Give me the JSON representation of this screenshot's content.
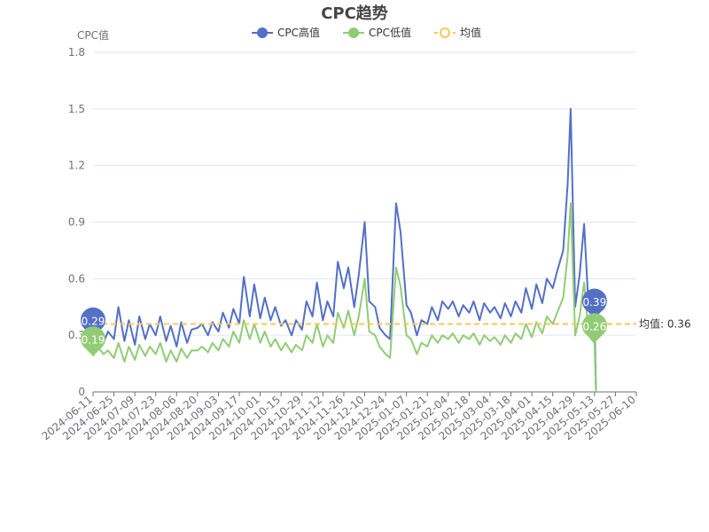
{
  "chart_data": {
    "type": "line",
    "title": "CPC趋势",
    "ylabel": "CPC值",
    "xlabel": "",
    "ylim": [
      0,
      1.8
    ],
    "yticks": [
      "0",
      "0.3",
      "0.6",
      "0.9",
      "1.2",
      "1.5",
      "1.8"
    ],
    "xticks": [
      "2024-06-11",
      "2024-06-25",
      "2024-07-09",
      "2024-07-23",
      "2024-08-06",
      "2024-08-20",
      "2024-09-03",
      "2024-09-17",
      "2024-10-01",
      "2024-10-15",
      "2024-10-29",
      "2024-11-12",
      "2024-11-26",
      "2024-12-10",
      "2024-12-24",
      "2025-01-07",
      "2025-01-21",
      "2025-02-04",
      "2025-02-18",
      "2025-03-04",
      "2025-03-18",
      "2025-04-01",
      "2025-04-15",
      "2025-04-29",
      "2025-05-13",
      "2025-05-27",
      "2025-06-10"
    ],
    "x_start": "2024-06-11",
    "x_end": "2025-06-10",
    "grid": true,
    "legend_position": "top-center",
    "series": [
      {
        "name": "CPC高值",
        "color": "#5470c6",
        "points": [
          [
            "2024-06-11",
            0.29
          ],
          [
            "2024-06-14",
            0.33
          ],
          [
            "2024-06-18",
            0.26
          ],
          [
            "2024-06-21",
            0.32
          ],
          [
            "2024-06-25",
            0.28
          ],
          [
            "2024-06-28",
            0.45
          ],
          [
            "2024-07-02",
            0.27
          ],
          [
            "2024-07-05",
            0.38
          ],
          [
            "2024-07-09",
            0.25
          ],
          [
            "2024-07-12",
            0.4
          ],
          [
            "2024-07-16",
            0.28
          ],
          [
            "2024-07-19",
            0.36
          ],
          [
            "2024-07-23",
            0.3
          ],
          [
            "2024-07-26",
            0.4
          ],
          [
            "2024-07-30",
            0.27
          ],
          [
            "2024-08-02",
            0.35
          ],
          [
            "2024-08-06",
            0.24
          ],
          [
            "2024-08-09",
            0.37
          ],
          [
            "2024-08-13",
            0.26
          ],
          [
            "2024-08-16",
            0.33
          ],
          [
            "2024-08-20",
            0.34
          ],
          [
            "2024-08-23",
            0.36
          ],
          [
            "2024-08-27",
            0.3
          ],
          [
            "2024-08-30",
            0.37
          ],
          [
            "2024-09-03",
            0.32
          ],
          [
            "2024-09-06",
            0.42
          ],
          [
            "2024-09-10",
            0.34
          ],
          [
            "2024-09-13",
            0.44
          ],
          [
            "2024-09-17",
            0.36
          ],
          [
            "2024-09-20",
            0.61
          ],
          [
            "2024-09-24",
            0.4
          ],
          [
            "2024-09-27",
            0.57
          ],
          [
            "2024-10-01",
            0.39
          ],
          [
            "2024-10-04",
            0.5
          ],
          [
            "2024-10-08",
            0.38
          ],
          [
            "2024-10-11",
            0.45
          ],
          [
            "2024-10-15",
            0.35
          ],
          [
            "2024-10-18",
            0.38
          ],
          [
            "2024-10-22",
            0.3
          ],
          [
            "2024-10-25",
            0.38
          ],
          [
            "2024-10-29",
            0.33
          ],
          [
            "2024-11-01",
            0.48
          ],
          [
            "2024-11-05",
            0.4
          ],
          [
            "2024-11-08",
            0.58
          ],
          [
            "2024-11-12",
            0.38
          ],
          [
            "2024-11-15",
            0.48
          ],
          [
            "2024-11-19",
            0.4
          ],
          [
            "2024-11-22",
            0.69
          ],
          [
            "2024-11-26",
            0.55
          ],
          [
            "2024-11-29",
            0.66
          ],
          [
            "2024-12-03",
            0.45
          ],
          [
            "2024-12-06",
            0.62
          ],
          [
            "2024-12-10",
            0.9
          ],
          [
            "2024-12-13",
            0.48
          ],
          [
            "2024-12-17",
            0.45
          ],
          [
            "2024-12-20",
            0.34
          ],
          [
            "2024-12-24",
            0.3
          ],
          [
            "2024-12-27",
            0.28
          ],
          [
            "2024-12-31",
            1.0
          ],
          [
            "2025-01-03",
            0.85
          ],
          [
            "2025-01-07",
            0.46
          ],
          [
            "2025-01-10",
            0.42
          ],
          [
            "2025-01-14",
            0.3
          ],
          [
            "2025-01-17",
            0.38
          ],
          [
            "2025-01-21",
            0.36
          ],
          [
            "2025-01-24",
            0.45
          ],
          [
            "2025-01-28",
            0.38
          ],
          [
            "2025-01-31",
            0.48
          ],
          [
            "2025-02-04",
            0.44
          ],
          [
            "2025-02-07",
            0.48
          ],
          [
            "2025-02-11",
            0.4
          ],
          [
            "2025-02-14",
            0.46
          ],
          [
            "2025-02-18",
            0.42
          ],
          [
            "2025-02-21",
            0.48
          ],
          [
            "2025-02-25",
            0.38
          ],
          [
            "2025-02-28",
            0.47
          ],
          [
            "2025-03-04",
            0.42
          ],
          [
            "2025-03-07",
            0.45
          ],
          [
            "2025-03-11",
            0.39
          ],
          [
            "2025-03-14",
            0.47
          ],
          [
            "2025-03-18",
            0.4
          ],
          [
            "2025-03-21",
            0.48
          ],
          [
            "2025-03-25",
            0.42
          ],
          [
            "2025-03-28",
            0.55
          ],
          [
            "2025-04-01",
            0.44
          ],
          [
            "2025-04-04",
            0.57
          ],
          [
            "2025-04-08",
            0.47
          ],
          [
            "2025-04-11",
            0.6
          ],
          [
            "2025-04-15",
            0.55
          ],
          [
            "2025-04-18",
            0.64
          ],
          [
            "2025-04-22",
            0.75
          ],
          [
            "2025-04-25",
            1.1
          ],
          [
            "2025-04-27",
            1.5
          ],
          [
            "2025-04-30",
            0.45
          ],
          [
            "2025-05-03",
            0.62
          ],
          [
            "2025-05-06",
            0.89
          ],
          [
            "2025-05-09",
            0.45
          ],
          [
            "2025-05-13",
            0.39
          ],
          [
            "2025-05-14",
            0.0
          ]
        ],
        "start_label": "0.29",
        "end_label": "0.39"
      },
      {
        "name": "CPC低值",
        "color": "#91cc75",
        "points": [
          [
            "2024-06-11",
            0.19
          ],
          [
            "2024-06-14",
            0.24
          ],
          [
            "2024-06-18",
            0.2
          ],
          [
            "2024-06-21",
            0.22
          ],
          [
            "2024-06-25",
            0.18
          ],
          [
            "2024-06-28",
            0.26
          ],
          [
            "2024-07-02",
            0.16
          ],
          [
            "2024-07-05",
            0.24
          ],
          [
            "2024-07-09",
            0.17
          ],
          [
            "2024-07-12",
            0.25
          ],
          [
            "2024-07-16",
            0.19
          ],
          [
            "2024-07-19",
            0.24
          ],
          [
            "2024-07-23",
            0.2
          ],
          [
            "2024-07-26",
            0.26
          ],
          [
            "2024-07-30",
            0.16
          ],
          [
            "2024-08-02",
            0.22
          ],
          [
            "2024-08-06",
            0.16
          ],
          [
            "2024-08-09",
            0.23
          ],
          [
            "2024-08-13",
            0.18
          ],
          [
            "2024-08-16",
            0.22
          ],
          [
            "2024-08-20",
            0.22
          ],
          [
            "2024-08-23",
            0.24
          ],
          [
            "2024-08-27",
            0.21
          ],
          [
            "2024-08-30",
            0.26
          ],
          [
            "2024-09-03",
            0.22
          ],
          [
            "2024-09-06",
            0.28
          ],
          [
            "2024-09-10",
            0.24
          ],
          [
            "2024-09-13",
            0.32
          ],
          [
            "2024-09-17",
            0.26
          ],
          [
            "2024-09-20",
            0.38
          ],
          [
            "2024-09-24",
            0.28
          ],
          [
            "2024-09-27",
            0.36
          ],
          [
            "2024-10-01",
            0.26
          ],
          [
            "2024-10-04",
            0.32
          ],
          [
            "2024-10-08",
            0.24
          ],
          [
            "2024-10-11",
            0.28
          ],
          [
            "2024-10-15",
            0.22
          ],
          [
            "2024-10-18",
            0.26
          ],
          [
            "2024-10-22",
            0.21
          ],
          [
            "2024-10-25",
            0.25
          ],
          [
            "2024-10-29",
            0.22
          ],
          [
            "2024-11-01",
            0.3
          ],
          [
            "2024-11-05",
            0.26
          ],
          [
            "2024-11-08",
            0.36
          ],
          [
            "2024-11-12",
            0.24
          ],
          [
            "2024-11-15",
            0.3
          ],
          [
            "2024-11-19",
            0.26
          ],
          [
            "2024-11-22",
            0.42
          ],
          [
            "2024-11-26",
            0.34
          ],
          [
            "2024-11-29",
            0.43
          ],
          [
            "2024-12-03",
            0.3
          ],
          [
            "2024-12-06",
            0.4
          ],
          [
            "2024-12-10",
            0.6
          ],
          [
            "2024-12-13",
            0.32
          ],
          [
            "2024-12-17",
            0.3
          ],
          [
            "2024-12-20",
            0.24
          ],
          [
            "2024-12-24",
            0.2
          ],
          [
            "2024-12-27",
            0.18
          ],
          [
            "2024-12-31",
            0.66
          ],
          [
            "2025-01-03",
            0.56
          ],
          [
            "2025-01-07",
            0.3
          ],
          [
            "2025-01-10",
            0.28
          ],
          [
            "2025-01-14",
            0.2
          ],
          [
            "2025-01-17",
            0.26
          ],
          [
            "2025-01-21",
            0.24
          ],
          [
            "2025-01-24",
            0.3
          ],
          [
            "2025-01-28",
            0.26
          ],
          [
            "2025-01-31",
            0.3
          ],
          [
            "2025-02-04",
            0.28
          ],
          [
            "2025-02-07",
            0.31
          ],
          [
            "2025-02-11",
            0.26
          ],
          [
            "2025-02-14",
            0.3
          ],
          [
            "2025-02-18",
            0.28
          ],
          [
            "2025-02-21",
            0.31
          ],
          [
            "2025-02-25",
            0.25
          ],
          [
            "2025-02-28",
            0.3
          ],
          [
            "2025-03-04",
            0.27
          ],
          [
            "2025-03-07",
            0.29
          ],
          [
            "2025-03-11",
            0.25
          ],
          [
            "2025-03-14",
            0.3
          ],
          [
            "2025-03-18",
            0.26
          ],
          [
            "2025-03-21",
            0.31
          ],
          [
            "2025-03-25",
            0.28
          ],
          [
            "2025-03-28",
            0.36
          ],
          [
            "2025-04-01",
            0.29
          ],
          [
            "2025-04-04",
            0.37
          ],
          [
            "2025-04-08",
            0.31
          ],
          [
            "2025-04-11",
            0.4
          ],
          [
            "2025-04-15",
            0.36
          ],
          [
            "2025-04-18",
            0.42
          ],
          [
            "2025-04-22",
            0.5
          ],
          [
            "2025-04-25",
            0.72
          ],
          [
            "2025-04-27",
            1.0
          ],
          [
            "2025-04-30",
            0.3
          ],
          [
            "2025-05-03",
            0.4
          ],
          [
            "2025-05-06",
            0.58
          ],
          [
            "2025-05-09",
            0.3
          ],
          [
            "2025-05-13",
            0.26
          ],
          [
            "2025-05-14",
            0.0
          ]
        ],
        "start_label": "0.19",
        "end_label": "0.26"
      }
    ],
    "average": {
      "name": "均值",
      "value": 0.36,
      "label": "均值: 0.36",
      "color": "#fac858"
    }
  }
}
